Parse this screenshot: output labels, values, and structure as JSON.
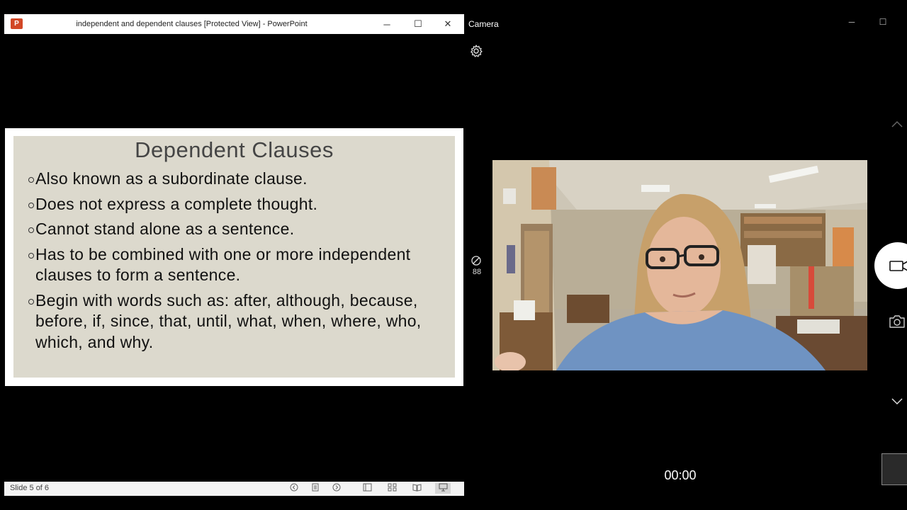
{
  "powerpoint": {
    "title": "independent and dependent clauses [Protected View] - PowerPoint",
    "app_icon_letter": "P",
    "icon": "powerpoint-app-icon",
    "minimize_glyph": "─",
    "maximize_glyph": "☐",
    "close_glyph": "✕"
  },
  "slide": {
    "title": "Dependent Clauses",
    "bullets": [
      "Also known as a subordinate clause.",
      "Does not express a complete thought.",
      "Cannot stand alone as a sentence.",
      "Has to be combined with one or more independent clauses to form a sentence.",
      "Begin with words such as: after, although, because, before, if, since, that, until, what, when, where, who, which, and why."
    ],
    "colors": {
      "panel": "#dcd9cd",
      "title": "#454545",
      "text": "#111111"
    }
  },
  "statusbar": {
    "slide_indicator": "Slide 5 of 6",
    "icons": [
      "previous-slide-icon",
      "notes-icon",
      "next-slide-icon",
      "normal-view-icon",
      "slide-sorter-icon",
      "reading-view-icon",
      "slideshow-icon"
    ],
    "active_icon": "slideshow-icon"
  },
  "camera": {
    "title": "Camera",
    "timer_value": "88",
    "recording_time": "00:00",
    "icons": [
      "settings-icon",
      "timer-icon",
      "chevron-up-icon",
      "video-mode-icon",
      "photo-mode-icon",
      "chevron-down-icon"
    ]
  }
}
